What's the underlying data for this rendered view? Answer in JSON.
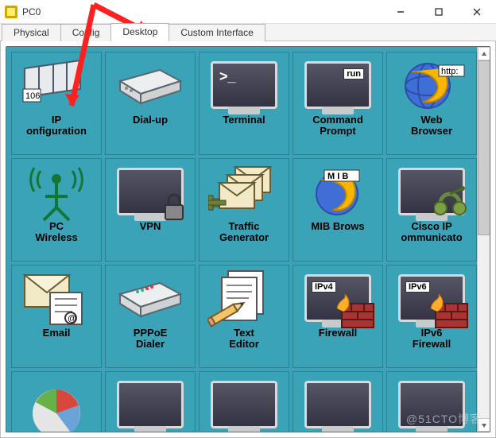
{
  "window": {
    "title": "PC0",
    "controls": {
      "min": "min",
      "max": "max",
      "close": "close"
    }
  },
  "tabs": [
    {
      "id": "physical",
      "label": "Physical",
      "active": false
    },
    {
      "id": "config",
      "label": "Config",
      "active": false
    },
    {
      "id": "desktop",
      "label": "Desktop",
      "active": true
    },
    {
      "id": "custom",
      "label": "Custom Interface",
      "active": false
    }
  ],
  "desktop": {
    "items": [
      {
        "id": "ip-config",
        "label": "IP\nonfiguration",
        "overlay": "106"
      },
      {
        "id": "dial-up",
        "label": "Dial-up"
      },
      {
        "id": "terminal",
        "label": "Terminal",
        "overlay": ">_"
      },
      {
        "id": "command-prompt",
        "label": "Command\nPrompt",
        "overlay": "run"
      },
      {
        "id": "web-browser",
        "label": "Web\nBrowser",
        "overlay": "http:"
      },
      {
        "id": "pc-wireless",
        "label": "PC\nWireless"
      },
      {
        "id": "vpn",
        "label": "VPN"
      },
      {
        "id": "traffic-generator",
        "label": "Traffic\nGenerator"
      },
      {
        "id": "mib-browser",
        "label": "MIB Brows",
        "overlay": "M I B"
      },
      {
        "id": "cisco-ip-comm",
        "label": "Cisco IP\nommunicato"
      },
      {
        "id": "email",
        "label": "Email"
      },
      {
        "id": "pppoe-dialer",
        "label": "PPPoE\nDialer"
      },
      {
        "id": "text-editor",
        "label": "Text\nEditor"
      },
      {
        "id": "firewall",
        "label": "Firewall",
        "overlay": "IPv4"
      },
      {
        "id": "ipv6-firewall",
        "label": "IPv6\nFirewall",
        "overlay": "IPv6"
      },
      {
        "id": "partial-1",
        "label": ""
      },
      {
        "id": "partial-2",
        "label": ""
      },
      {
        "id": "partial-3",
        "label": ""
      },
      {
        "id": "partial-4",
        "label": ""
      },
      {
        "id": "partial-5",
        "label": ""
      }
    ]
  },
  "watermark": "@51CTO博客"
}
